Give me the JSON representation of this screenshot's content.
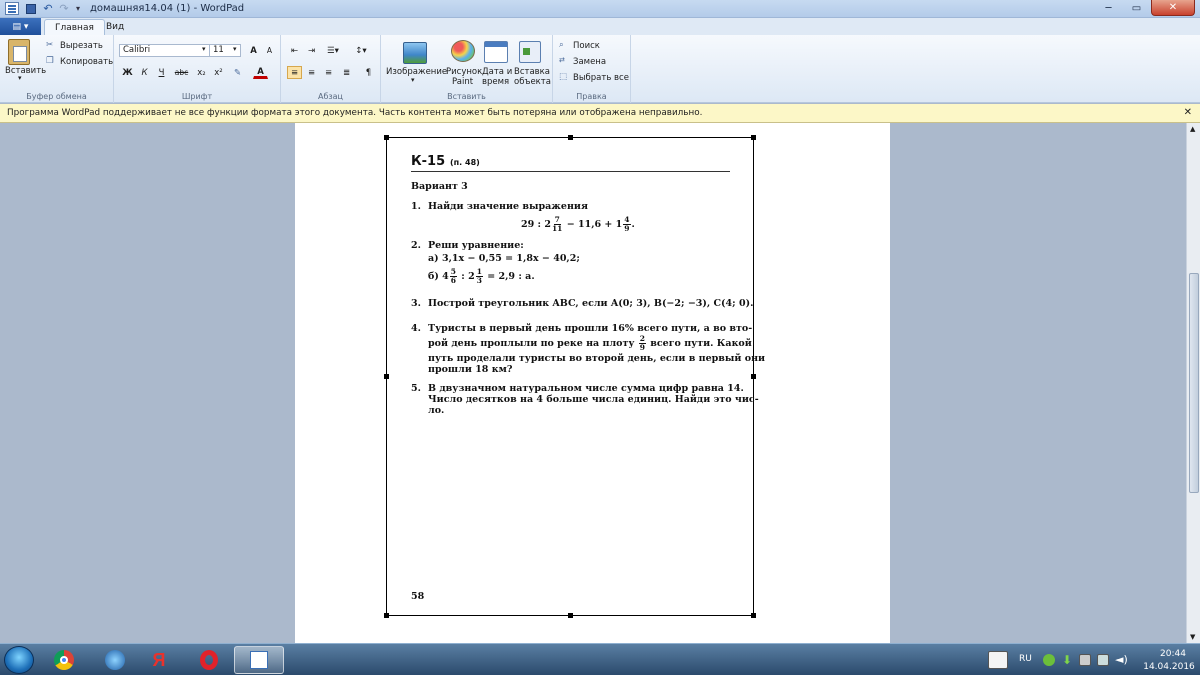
{
  "window": {
    "title": "домашняя14.04 (1) - WordPad",
    "minimize": "─",
    "maximize": "▭",
    "close": "✕"
  },
  "tabs": {
    "file": "▤ ▾",
    "home": "Главная",
    "view": "Вид"
  },
  "ribbon": {
    "clipboard": {
      "paste": "Вставить",
      "cut": "Вырезать",
      "copy": "Копировать",
      "label": "Буфер обмена"
    },
    "font": {
      "family": "Calibri",
      "size": "11",
      "grow": "A",
      "shrink": "A",
      "bold": "Ж",
      "italic": "К",
      "underline": "Ч",
      "strike": "abc",
      "subscript": "x₂",
      "superscript": "x²",
      "label": "Шрифт"
    },
    "paragraph": {
      "label": "Абзац"
    },
    "insert": {
      "picture": "Изображение",
      "paint1": "Рисунок",
      "paint2": "Paint",
      "date1": "Дата и",
      "date2": "время",
      "object1": "Вставка",
      "object2": "объекта",
      "label": "Вставить"
    },
    "editing": {
      "find": "Поиск",
      "replace": "Замена",
      "select_all": "Выбрать все",
      "label": "Правка"
    }
  },
  "infobar": {
    "message": "Программа WordPad поддерживает не все функции формата этого документа. Часть контента может быть потеряна или отображена неправильно.",
    "close": "✕"
  },
  "document": {
    "heading": "К-15",
    "heading_ref": "(п. 48)",
    "variant": "Вариант 3",
    "task1_num": "1.",
    "task1_text": "Найди значение выражения",
    "task1_expr_a": "29 : 2",
    "task1_f1_num": "7",
    "task1_f1_den": "11",
    "task1_expr_b": "− 11,6 + 1",
    "task1_f2_num": "4",
    "task1_f2_den": "9",
    "task1_expr_c": ".",
    "task2_num": "2.",
    "task2_text": "Реши уравнение:",
    "task2a": "а)  3,1x − 0,55 = 1,8x − 40,2;",
    "task2b_pre": "б)  4",
    "task2b_f1_num": "5",
    "task2b_f1_den": "6",
    "task2b_mid": ": 2",
    "task2b_f2_num": "1",
    "task2b_f2_den": "3",
    "task2b_post": "= 2,9 : a.",
    "task3_num": "3.",
    "task3_text": "Построй треугольник ABC, если A(0; 3), B(−2; −3), C(4; 0).",
    "task4_num": "4.",
    "task4_l1": "Туристы в первый день прошли 16% всего пути, а во вто-",
    "task4_l2_pre": "рой день проплыли по реке на плоту",
    "task4_f_num": "2",
    "task4_f_den": "9",
    "task4_l2_post": "всего пути. Какой",
    "task4_l3": "путь проделали туристы во второй день, если в первый они",
    "task4_l4": "прошли 18 км?",
    "task5_num": "5.",
    "task5_l1": "В двузначном натуральном числе сумма цифр равна 14.",
    "task5_l2": "Число десятков на 4 больше числа единиц. Найди это чис-",
    "task5_l3": "ло.",
    "page_number": "58"
  },
  "taskbar": {
    "lang": "RU",
    "time": "20:44",
    "date": "14.04.2016"
  }
}
